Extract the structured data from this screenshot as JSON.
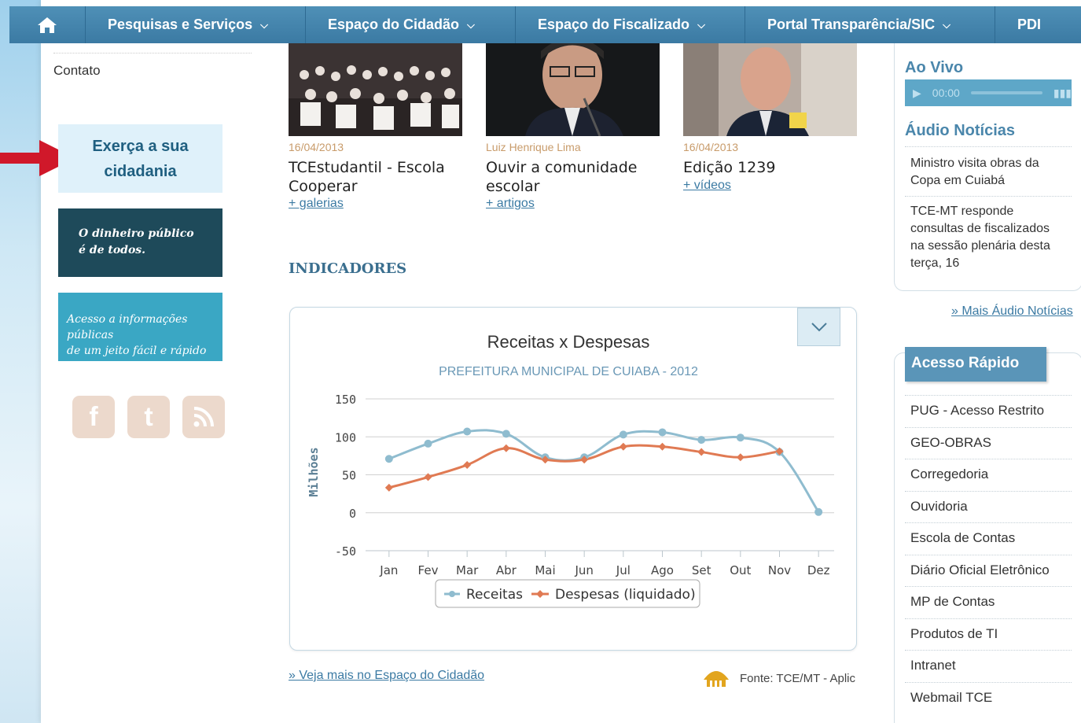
{
  "nav": {
    "items": [
      {
        "label": "Pesquisas e Serviços"
      },
      {
        "label": "Espaço do Cidadão"
      },
      {
        "label": "Espaço do Fiscalizado"
      },
      {
        "label": "Portal Transparência/SIC"
      },
      {
        "label": "PDI"
      }
    ]
  },
  "sidebar": {
    "contato": "Contato",
    "cidadania_line1": "Exerça a sua",
    "cidadania_line2": "cidadania",
    "dinheiro_line1": "O dinheiro público",
    "dinheiro_line2": "é de todos.",
    "acesso_line1": "Acesso a informações públicas",
    "acesso_line2": "de um jeito fácil e rápido",
    "social": [
      "f",
      "t",
      "rss"
    ]
  },
  "news": [
    {
      "date": "16/04/2013",
      "title_line1": "TCEstudantil - Escola",
      "title_line2": "Cooperar",
      "link": "+ galerias"
    },
    {
      "date": "Luiz Henrique Lima",
      "title_line1": "Ouvir a comunidade",
      "title_line2": "escolar",
      "link": "+ artigos"
    },
    {
      "date": "16/04/2013",
      "title_line1": "Edição 1239",
      "title_line2": "",
      "link": "+ vídeos"
    }
  ],
  "indicadores": {
    "title": "INDICADORES",
    "veja_mais": "» Veja mais no Espaço do Cidadão",
    "fonte": "Fonte: TCE/MT - Aplic"
  },
  "chart_data": {
    "type": "line",
    "title": "Receitas x Despesas",
    "subtitle": "PREFEITURA MUNICIPAL DE CUIABA - 2012",
    "xlabel": "",
    "ylabel": "Milhões",
    "categories": [
      "Jan",
      "Fev",
      "Mar",
      "Abr",
      "Mai",
      "Jun",
      "Jul",
      "Ago",
      "Set",
      "Out",
      "Nov",
      "Dez"
    ],
    "yticks": [
      150,
      100,
      50,
      0,
      -50
    ],
    "ylim": [
      -50,
      150
    ],
    "grid": true,
    "legend_position": "bottom",
    "series": [
      {
        "name": "Receitas",
        "color": "#8fbccf",
        "values": [
          71,
          91,
          107,
          104,
          73,
          73,
          103,
          106,
          96,
          99,
          80,
          1
        ]
      },
      {
        "name": "Despesas (liquidado)",
        "color": "#e07a53",
        "values": [
          33,
          47,
          63,
          85,
          70,
          70,
          87,
          87,
          80,
          73,
          81,
          null
        ]
      }
    ]
  },
  "right": {
    "ao_vivo": "Ao Vivo",
    "player_time": "00:00",
    "audio_noticias": "Áudio Notícias",
    "audio_items": [
      {
        "line1": "Ministro visita obras da",
        "line2": "Copa em Cuiabá"
      },
      {
        "line1": "TCE-MT responde",
        "line2": "consultas de fiscalizados",
        "line3": "na sessão plenária desta",
        "line4": "terça, 16"
      }
    ],
    "mais_audio": "» Mais Áudio Notícias",
    "acesso_rapido": "Acesso Rápido",
    "rapido_items": [
      "PUG - Acesso Restrito",
      "GEO-OBRAS",
      "Corregedoria",
      "Ouvidoria",
      "Escola de Contas",
      "Diário Oficial Eletrônico",
      "MP de Contas",
      "Produtos de TI",
      "Intranet",
      "Webmail TCE"
    ]
  }
}
